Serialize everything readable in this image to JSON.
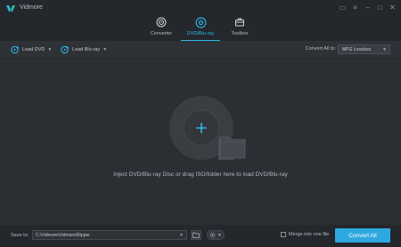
{
  "app": {
    "title": "Vidmore",
    "logo_icon": "vidmore-logo-icon"
  },
  "window_controls": [
    {
      "name": "feedback-icon",
      "glyph": "▭"
    },
    {
      "name": "menu-icon",
      "glyph": "≡"
    },
    {
      "name": "minimize-icon",
      "glyph": "–"
    },
    {
      "name": "maximize-icon",
      "glyph": "□"
    },
    {
      "name": "close-icon",
      "glyph": "✕"
    }
  ],
  "tabs": [
    {
      "label": "Converter",
      "icon": "converter-icon",
      "active": false
    },
    {
      "label": "DVD/Blu-ray",
      "icon": "disc-icon",
      "active": true
    },
    {
      "label": "Toolbox",
      "icon": "toolbox-icon",
      "active": false
    }
  ],
  "toolbar": {
    "load_dvd": "Load DVD",
    "load_bluray": "Load Blu-ray",
    "convert_all_to": "Convert All to:",
    "format_value": "MPG Lossless"
  },
  "main": {
    "hint": "Inject DVD/Blu-ray Disc or drag ISO/folder here to load DVD/Blu-ray"
  },
  "bottom": {
    "save_to_label": "Save to:",
    "save_path": "C:\\Vidmore\\Vidmore\\Ripper",
    "merge_label": "Merge into one file",
    "merge_checked": false,
    "convert_all_label": "Convert All"
  },
  "colors": {
    "accent": "#2fb9ea",
    "button": "#2fa8e0",
    "background": "#2b2e33",
    "titlebar": "#24272c"
  }
}
